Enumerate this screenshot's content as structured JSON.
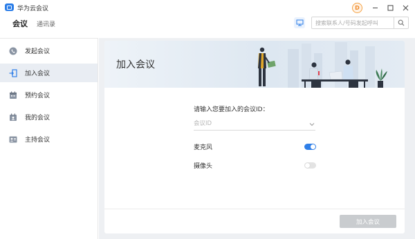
{
  "window": {
    "title": "华为云会议",
    "avatar_letter": "D",
    "controls": [
      "minimize-icon",
      "maximize-icon",
      "close-icon"
    ]
  },
  "tabs": [
    {
      "label": "会议",
      "active": true
    },
    {
      "label": "通讯录",
      "active": false
    }
  ],
  "search": {
    "placeholder": "搜索联系人/号码发起呼叫",
    "value": "",
    "icon": "search-icon"
  },
  "sidebar": {
    "items": [
      {
        "label": "发起会议",
        "icon": "phone-icon",
        "active": false
      },
      {
        "label": "加入会议",
        "icon": "join-icon",
        "active": true
      },
      {
        "label": "预约会议",
        "icon": "calendar-icon",
        "active": false
      },
      {
        "label": "我的会议",
        "icon": "my-meetings-icon",
        "active": false
      },
      {
        "label": "主持会议",
        "icon": "host-icon",
        "active": false
      }
    ]
  },
  "join": {
    "banner_title": "加入会议",
    "prompt": "请输入您要加入的会议ID：",
    "id_placeholder": "会议ID",
    "id_value": "",
    "options": [
      {
        "label": "麦克风",
        "enabled": true
      },
      {
        "label": "摄像头",
        "enabled": false
      }
    ],
    "join_button": "加入会议"
  },
  "colors": {
    "accent": "#2f7fe8",
    "sidebar_active_bg": "#e9edf3",
    "main_bg": "#eef0f3",
    "button_disabled": "#c9cccf",
    "avatar_orange": "#f08a2a"
  }
}
